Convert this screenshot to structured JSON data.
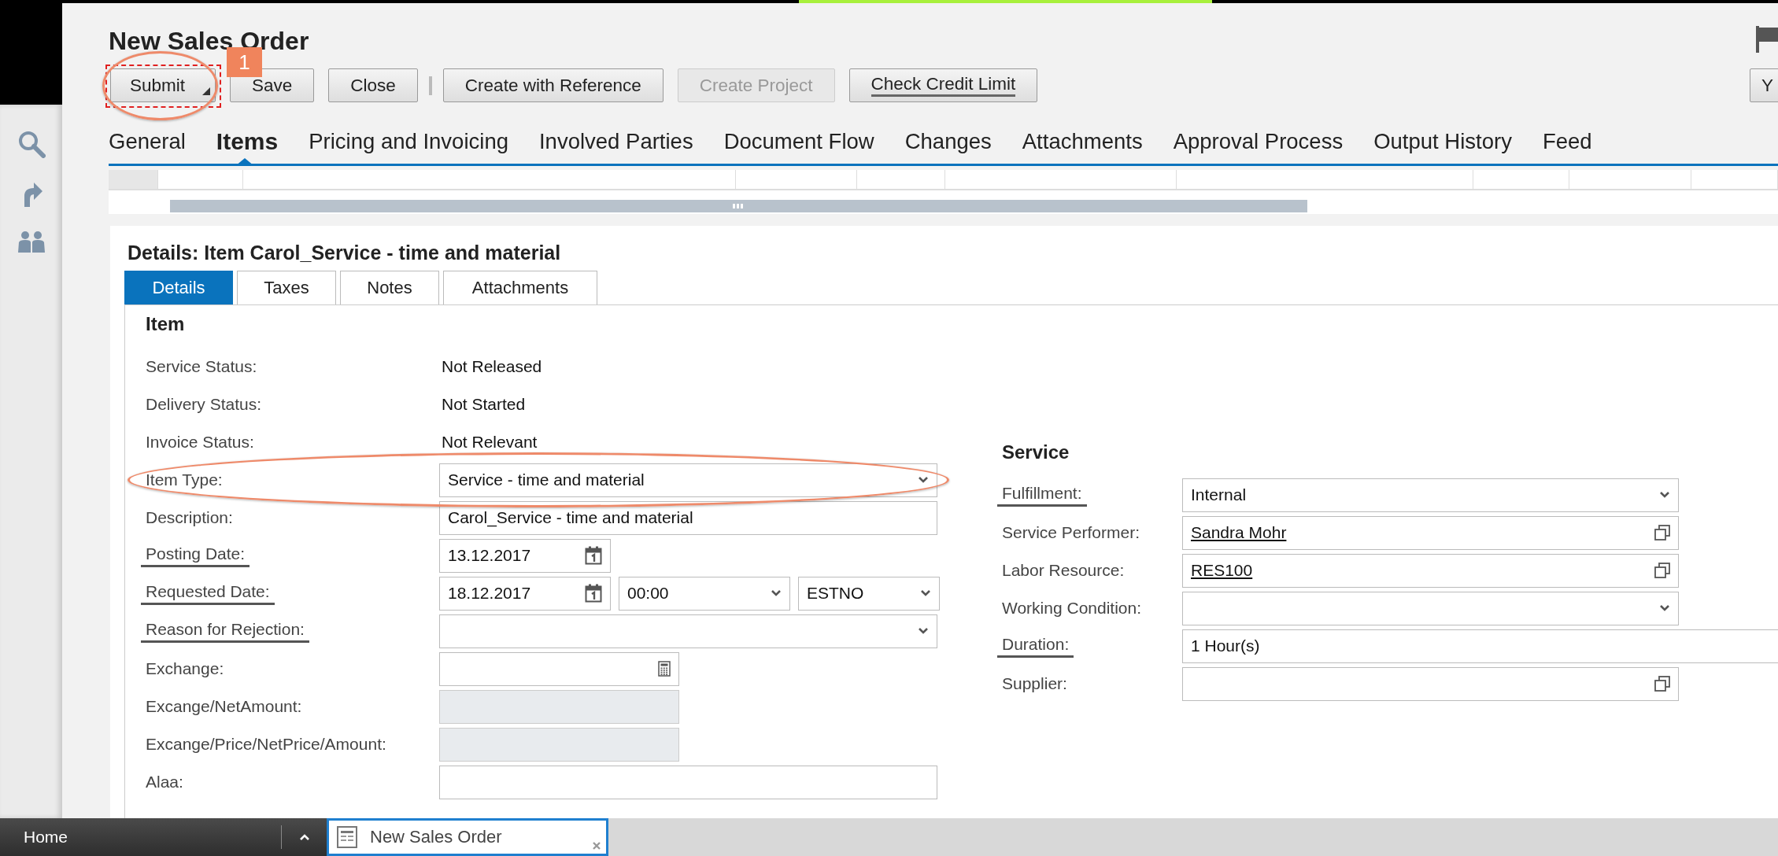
{
  "window": {
    "title": "New Sales Order"
  },
  "toolbar": {
    "buttons": [
      {
        "kind": "button",
        "label": "Submit",
        "disabled": false,
        "menu": true,
        "focused": false,
        "highlighted": true,
        "badge": "1"
      },
      {
        "kind": "button",
        "label": "Save",
        "disabled": false,
        "menu": false,
        "focused": false,
        "highlighted": false
      },
      {
        "kind": "button",
        "label": "Close",
        "disabled": false,
        "menu": false,
        "focused": false,
        "highlighted": false
      },
      {
        "kind": "separator"
      },
      {
        "kind": "button",
        "label": "Create with Reference",
        "disabled": false,
        "menu": false,
        "focused": false,
        "highlighted": false
      },
      {
        "kind": "button",
        "label": "Create Project",
        "disabled": true,
        "menu": false,
        "focused": false,
        "highlighted": false
      },
      {
        "kind": "button",
        "label": "Check Credit Limit",
        "disabled": false,
        "menu": false,
        "focused": true,
        "highlighted": false
      }
    ],
    "right_button": "Y"
  },
  "tabs": [
    {
      "label": "General",
      "selected": false
    },
    {
      "label": "Items",
      "selected": true
    },
    {
      "label": "Pricing and Invoicing",
      "selected": false
    },
    {
      "label": "Involved Parties",
      "selected": false
    },
    {
      "label": "Document Flow",
      "selected": false
    },
    {
      "label": "Changes",
      "selected": false
    },
    {
      "label": "Attachments",
      "selected": false
    },
    {
      "label": "Approval Process",
      "selected": false
    },
    {
      "label": "Output History",
      "selected": false
    },
    {
      "label": "Feed",
      "selected": false
    }
  ],
  "details": {
    "title": "Details: Item Carol_Service - time and material",
    "tabs": [
      {
        "label": "Details",
        "selected": true
      },
      {
        "label": "Taxes",
        "selected": false
      },
      {
        "label": "Notes",
        "selected": false
      },
      {
        "label": "Attachments",
        "selected": false
      }
    ],
    "item_section": {
      "title": "Item",
      "rows": [
        {
          "label": "Service Status:",
          "kind": "text",
          "value": "Not Released",
          "underlined": false
        },
        {
          "label": "Delivery Status:",
          "kind": "text",
          "value": "Not Started",
          "underlined": false
        },
        {
          "label": "Invoice Status:",
          "kind": "text",
          "value": "Not Relevant",
          "underlined": false
        },
        {
          "label": "Item Type:",
          "kind": "select",
          "value": "Service - time and material",
          "underlined": false,
          "highlighted": true
        },
        {
          "label": "Description:",
          "kind": "input",
          "value": "Carol_Service - time and material",
          "underlined": false
        },
        {
          "label": "Posting Date:",
          "kind": "date",
          "value": "13.12.2017",
          "underlined": true
        },
        {
          "label": "Requested Date:",
          "kind": "datetime",
          "value": "18.12.2017",
          "time": "00:00",
          "timezone": "ESTNO",
          "underlined": true
        },
        {
          "label": "Reason for Rejection:",
          "kind": "select",
          "underlined": true
        },
        {
          "label": "Exchange:",
          "kind": "calc",
          "underlined": false
        },
        {
          "label": "Excange/NetAmount:",
          "kind": "readonly",
          "underlined": false
        },
        {
          "label": "Excange/Price/NetPrice/Amount:",
          "kind": "readonly",
          "underlined": false
        },
        {
          "label": "Alaa:",
          "kind": "input",
          "underlined": false
        }
      ]
    },
    "service_section": {
      "title": "Service",
      "rows": [
        {
          "label": "Fulfillment:",
          "kind": "select",
          "value": "Internal",
          "underlined": true,
          "link": false
        },
        {
          "label": "Service Performer:",
          "kind": "lookup",
          "value": "Sandra Mohr",
          "underlined": false,
          "link": true
        },
        {
          "label": "Labor Resource:",
          "kind": "lookup",
          "value": "RES100",
          "underlined": false,
          "link": true
        },
        {
          "label": "Working Condition:",
          "kind": "select",
          "underlined": false
        },
        {
          "label": "Duration:",
          "kind": "input",
          "value": "1 Hour(s)",
          "underlined": true,
          "link": false
        },
        {
          "label": "Supplier:",
          "kind": "lookup",
          "underlined": false
        }
      ]
    }
  },
  "taskbar": {
    "home": "Home",
    "tabs": [
      {
        "label": "New Sales Order",
        "selected": true
      }
    ]
  }
}
